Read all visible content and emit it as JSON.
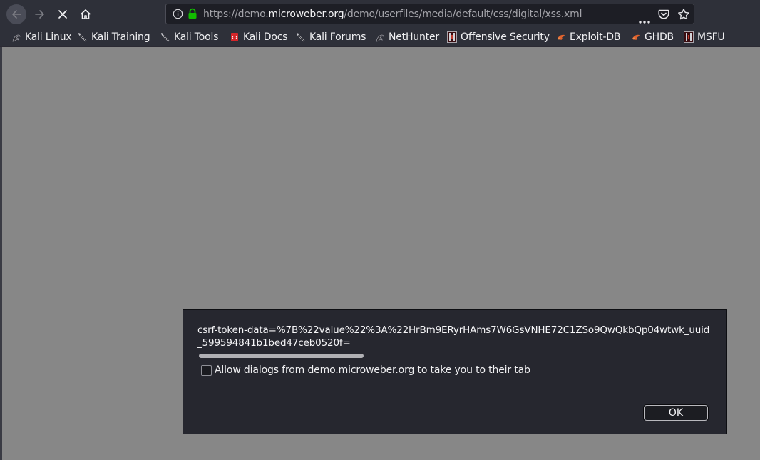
{
  "toolbar": {
    "url_prefix": "https://demo.",
    "url_host": "microweber.org",
    "url_path": "/demo/userfiles/media/default/css/digital/xss.xml",
    "colors": {
      "toolbar_bg": "#2e3039",
      "url_bg": "#1d1e25",
      "lock": "#12bc00"
    }
  },
  "bookmarks": [
    {
      "label": "Kali Linux",
      "icon": "kali-dragon-icon"
    },
    {
      "label": "Kali Training",
      "icon": "kali-sword-icon"
    },
    {
      "label": "Kali Tools",
      "icon": "kali-sword-icon"
    },
    {
      "label": "Kali Docs",
      "icon": "kali-docs-icon"
    },
    {
      "label": "Kali Forums",
      "icon": "kali-sword-icon"
    },
    {
      "label": "NetHunter",
      "icon": "kali-dragon-icon"
    },
    {
      "label": "Offensive Security",
      "icon": "offsec-icon"
    },
    {
      "label": "Exploit-DB",
      "icon": "exploitdb-icon"
    },
    {
      "label": "GHDB",
      "icon": "exploitdb-icon"
    },
    {
      "label": "MSFU",
      "icon": "offsec-icon"
    }
  ],
  "content": {
    "bg_color": "#878787"
  },
  "dialog": {
    "message": "csrf-token-data=%7B%22value%22%3A%22HrBm9ERyrHAms7W6GsVNHE72C1ZSo9QwQkbQp04wtwk_uuid_599594841b1bed47ceb0520f=",
    "checkbox_label": "Allow dialogs from demo.microweber.org to take you to their tab",
    "checkbox_checked": false,
    "ok_label": "OK"
  }
}
